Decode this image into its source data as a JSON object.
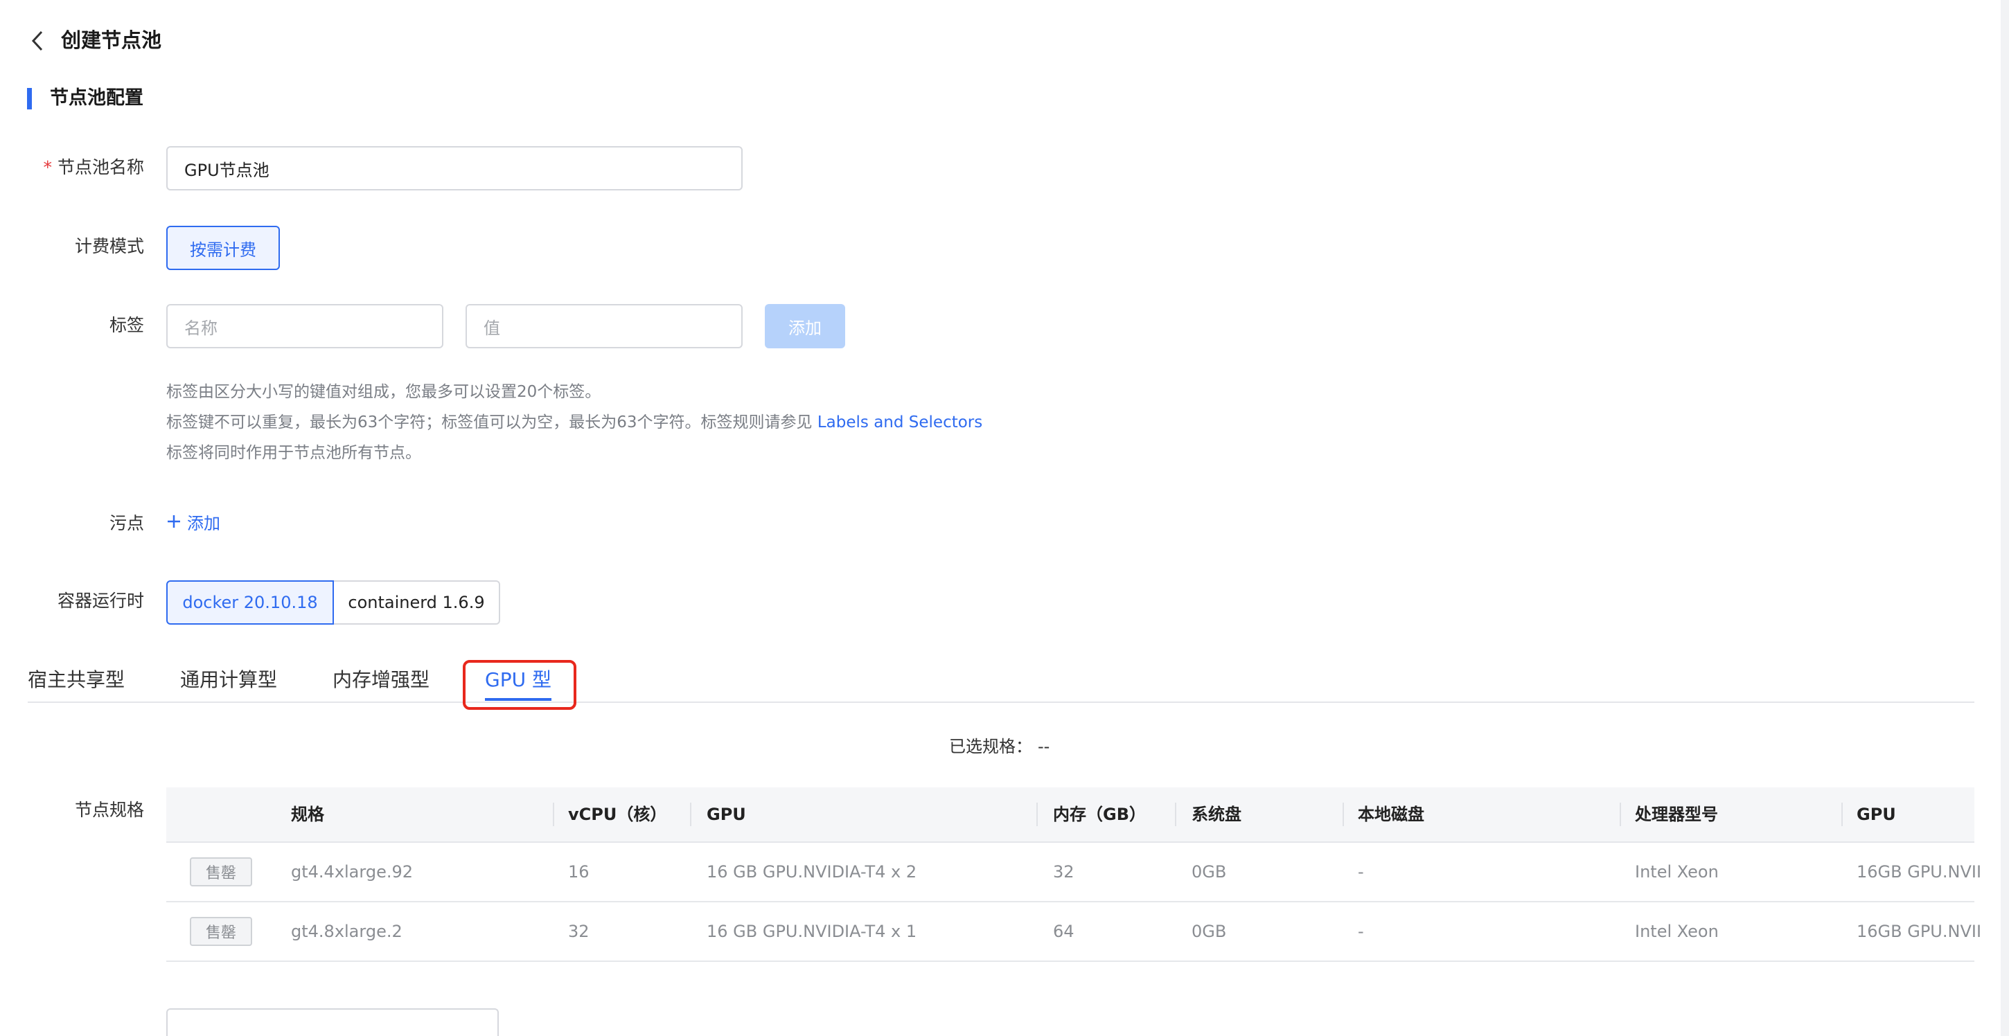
{
  "header": {
    "title": "创建节点池"
  },
  "section": {
    "title": "节点池配置"
  },
  "form": {
    "name_label": "节点池名称",
    "required_mark": "*",
    "name_value": "GPU节点池",
    "billing_label": "计费模式",
    "billing_option": "按需计费",
    "tags_label": "标签",
    "tag_key_placeholder": "名称",
    "tag_value_placeholder": "值",
    "tag_add_button": "添加",
    "tag_hints": [
      "标签由区分大小写的键值对组成，您最多可以设置20个标签。",
      "标签键不可以重复，最长为63个字符；标签值可以为空，最长为63个字符。标签规则请参见 ",
      "标签将同时作用于节点池所有节点。"
    ],
    "tag_hint_link": "Labels and Selectors",
    "taint_label": "污点",
    "taint_add": "添加",
    "runtime_label": "容器运行时",
    "runtime_options": [
      "docker 20.10.18",
      "containerd 1.6.9"
    ],
    "spec_label": "节点规格"
  },
  "tabs": [
    {
      "label": "宿主共享型",
      "active": false
    },
    {
      "label": "通用计算型",
      "active": false
    },
    {
      "label": "内存增强型",
      "active": false
    },
    {
      "label": "GPU 型",
      "active": true
    }
  ],
  "selected_spec": {
    "label": "已选规格：",
    "value": "--"
  },
  "table": {
    "columns": [
      "规格",
      "vCPU（核）",
      "GPU",
      "内存（GB）",
      "系统盘",
      "本地磁盘",
      "处理器型号",
      "GPU"
    ],
    "rows": [
      {
        "status": "售罄",
        "spec": "gt4.4xlarge.92",
        "vcpu": "16",
        "gpu": "16 GB GPU.NVIDIA-T4 x 2",
        "memory": "32",
        "system_disk": "0GB",
        "local_disk": "-",
        "cpu_model": "Intel Xeon",
        "gpu2": "16GB GPU.NVII"
      },
      {
        "status": "售罄",
        "spec": "gt4.8xlarge.2",
        "vcpu": "32",
        "gpu": "16 GB GPU.NVIDIA-T4 x 1",
        "memory": "64",
        "system_disk": "0GB",
        "local_disk": "-",
        "cpu_model": "Intel Xeon",
        "gpu2": "16GB GPU.NVII"
      }
    ]
  },
  "colors": {
    "accent": "#2f6bf0",
    "highlight": "#e8281d",
    "required": "#e5383b"
  },
  "icons": {
    "back": "chevron-left-icon",
    "add": "plus-icon"
  }
}
